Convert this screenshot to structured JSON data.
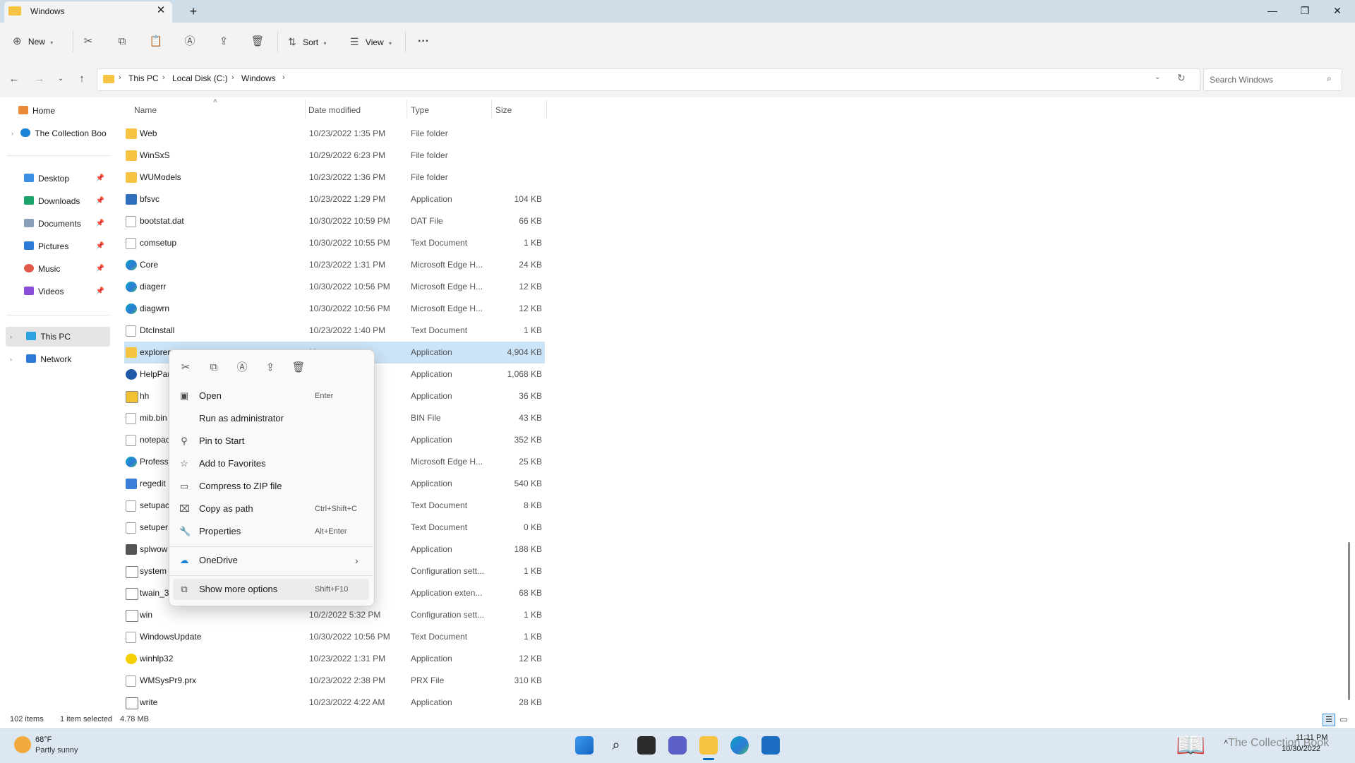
{
  "window": {
    "tab_title": "Windows",
    "tab_close": "✕",
    "new_tab": "+",
    "minimize": "—",
    "maximize": "❐",
    "close": "✕"
  },
  "toolbar": {
    "new_label": "New",
    "sort_label": "Sort",
    "view_label": "View",
    "more": "···",
    "icons": [
      "cut-icon",
      "copy-icon",
      "paste-icon",
      "rename-icon",
      "share-icon",
      "delete-icon"
    ]
  },
  "address": {
    "crumbs": [
      "This PC",
      "Local Disk (C:)",
      "Windows"
    ],
    "search_placeholder": "Search Windows"
  },
  "sidebar": {
    "items": [
      {
        "label": "Home"
      },
      {
        "label": "The Collection Boo"
      },
      {
        "label": "Desktop"
      },
      {
        "label": "Downloads"
      },
      {
        "label": "Documents"
      },
      {
        "label": "Pictures"
      },
      {
        "label": "Music"
      },
      {
        "label": "Videos"
      },
      {
        "label": "This PC"
      },
      {
        "label": "Network"
      }
    ]
  },
  "columns": {
    "name": "Name",
    "date": "Date modified",
    "type": "Type",
    "size": "Size"
  },
  "files": [
    {
      "name": "Web",
      "date": "10/23/2022 1:35 PM",
      "type": "File folder",
      "size": "",
      "icon": "folder"
    },
    {
      "name": "WinSxS",
      "date": "10/29/2022 6:23 PM",
      "type": "File folder",
      "size": "",
      "icon": "folder"
    },
    {
      "name": "WUModels",
      "date": "10/23/2022 1:36 PM",
      "type": "File folder",
      "size": "",
      "icon": "folder"
    },
    {
      "name": "bfsvc",
      "date": "10/23/2022 1:29 PM",
      "type": "Application",
      "size": "104 KB",
      "icon": "app"
    },
    {
      "name": "bootstat.dat",
      "date": "10/30/2022 10:59 PM",
      "type": "DAT File",
      "size": "66 KB",
      "icon": "file"
    },
    {
      "name": "comsetup",
      "date": "10/30/2022 10:55 PM",
      "type": "Text Document",
      "size": "1 KB",
      "icon": "file"
    },
    {
      "name": "Core",
      "date": "10/23/2022 1:31 PM",
      "type": "Microsoft Edge H...",
      "size": "24 KB",
      "icon": "edge"
    },
    {
      "name": "diagerr",
      "date": "10/30/2022 10:56 PM",
      "type": "Microsoft Edge H...",
      "size": "12 KB",
      "icon": "edge"
    },
    {
      "name": "diagwrn",
      "date": "10/30/2022 10:56 PM",
      "type": "Microsoft Edge H...",
      "size": "12 KB",
      "icon": "edge"
    },
    {
      "name": "DtcInstall",
      "date": "10/23/2022 1:40 PM",
      "type": "Text Document",
      "size": "1 KB",
      "icon": "file"
    },
    {
      "name": "explorer",
      "date": "M",
      "type": "Application",
      "size": "4,904 KB",
      "icon": "folder",
      "selected": true
    },
    {
      "name": "HelpPar",
      "date": "M",
      "type": "Application",
      "size": "1,068 KB",
      "icon": "help"
    },
    {
      "name": "hh",
      "date": "M",
      "type": "Application",
      "size": "36 KB",
      "icon": "hh"
    },
    {
      "name": "mib.bin",
      "date": "M",
      "type": "BIN File",
      "size": "43 KB",
      "icon": "file"
    },
    {
      "name": "notepac",
      "date": "M",
      "type": "Application",
      "size": "352 KB",
      "icon": "file"
    },
    {
      "name": "Professi",
      "date": "M",
      "type": "Microsoft Edge H...",
      "size": "25 KB",
      "icon": "edge"
    },
    {
      "name": "regedit",
      "date": "M",
      "type": "Application",
      "size": "540 KB",
      "icon": "reg"
    },
    {
      "name": "setupac",
      "date": "PM",
      "type": "Text Document",
      "size": "8 KB",
      "icon": "file"
    },
    {
      "name": "setuper",
      "date": "PM",
      "type": "Text Document",
      "size": "0 KB",
      "icon": "file"
    },
    {
      "name": "splwow",
      "date": "M",
      "type": "Application",
      "size": "188 KB",
      "icon": "print"
    },
    {
      "name": "system",
      "date": "M",
      "type": "Configuration sett...",
      "size": "1 KB",
      "icon": "sys"
    },
    {
      "name": "twain_3",
      "date": "M",
      "type": "Application exten...",
      "size": "68 KB",
      "icon": "sys"
    },
    {
      "name": "win",
      "date": "10/2/2022 5:32 PM",
      "type": "Configuration sett...",
      "size": "1 KB",
      "icon": "sys"
    },
    {
      "name": "WindowsUpdate",
      "date": "10/30/2022 10:56 PM",
      "type": "Text Document",
      "size": "1 KB",
      "icon": "file"
    },
    {
      "name": "winhlp32",
      "date": "10/23/2022 1:31 PM",
      "type": "Application",
      "size": "12 KB",
      "icon": "bulb"
    },
    {
      "name": "WMSysPr9.prx",
      "date": "10/23/2022 2:38 PM",
      "type": "PRX File",
      "size": "310 KB",
      "icon": "file"
    },
    {
      "name": "write",
      "date": "10/23/2022 4:22 AM",
      "type": "Application",
      "size": "28 KB",
      "icon": "write"
    }
  ],
  "context_menu": {
    "items": [
      {
        "label": "Open",
        "shortcut": "Enter"
      },
      {
        "label": "Run as administrator",
        "shortcut": ""
      },
      {
        "label": "Pin to Start",
        "shortcut": ""
      },
      {
        "label": "Add to Favorites",
        "shortcut": ""
      },
      {
        "label": "Compress to ZIP file",
        "shortcut": ""
      },
      {
        "label": "Copy as path",
        "shortcut": "Ctrl+Shift+C"
      },
      {
        "label": "Properties",
        "shortcut": "Alt+Enter"
      },
      {
        "label": "OneDrive",
        "shortcut": "›"
      },
      {
        "label": "Show more options",
        "shortcut": "Shift+F10"
      }
    ]
  },
  "status": {
    "item_count": "102 items",
    "selection": "1 item selected",
    "size": "4.78 MB"
  },
  "taskbar": {
    "weather_temp": "68°F",
    "weather_desc": "Partly sunny",
    "time": "11:11 PM",
    "date": "10/30/2022",
    "watermark": "The Collection Book"
  },
  "colors": {
    "accent": "#0067c0",
    "selection": "#cce4f7",
    "folder": "#f6c343"
  }
}
